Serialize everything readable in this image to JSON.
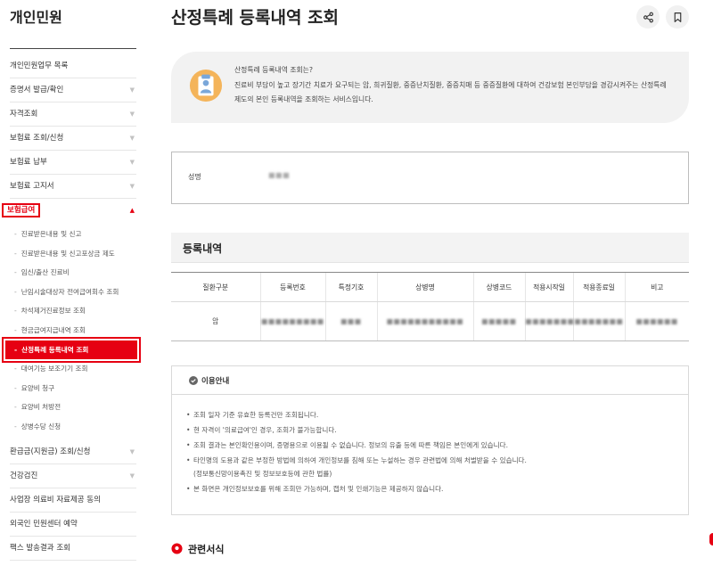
{
  "sidebar": {
    "title": "개인민원",
    "items": [
      {
        "label": "개인민원업무 목록",
        "has_arrow": false
      },
      {
        "label": "증명서 발급/확인",
        "has_arrow": true
      },
      {
        "label": "자격조회",
        "has_arrow": true
      },
      {
        "label": "보험료 조회/신청",
        "has_arrow": true
      },
      {
        "label": "보험료 납부",
        "has_arrow": true
      },
      {
        "label": "보험료 고지서",
        "has_arrow": true
      }
    ],
    "active_item": {
      "label": "보험급여",
      "arrow": "▲"
    },
    "sub_items": [
      "진료받은내용 및 신고",
      "진료받은내용 및 신고포상금 제도",
      "임신/출산 진료비",
      "난임시술대상자 전여급여회수 조회",
      "차석제거진료정보 조회",
      "현금급여지급내역 조회",
      "산정특례 등록내역 조회",
      "대여기능 보조기기 조회",
      "요양비 청구",
      "요양비 처방전",
      "상병수당 신청"
    ],
    "items_after": [
      {
        "label": "환급금(지원금) 조회/신청",
        "has_arrow": true
      },
      {
        "label": "건강검진",
        "has_arrow": true
      },
      {
        "label": "사업장 의료비 자료제공 동의",
        "has_arrow": false
      },
      {
        "label": "외국인 민원센터 예약",
        "has_arrow": false
      },
      {
        "label": "팩스 발송결과 조회",
        "has_arrow": false
      }
    ],
    "arrow_glyph": "▼"
  },
  "page": {
    "title": "산정특례 등록내역 조회",
    "share_icon": "share-icon",
    "bookmark_icon": "bookmark-icon"
  },
  "intro": {
    "question": "산정특례 등록내역 조회는?",
    "description": "진료비 부담이 높고 장기간 치료가 요구되는 암, 희귀질환, 중증난치질환, 중증치매 등 중증질환에 대하여 건강보험 본인부담을 경감시켜주는 산정특례 제도의 본인 등록내역을 조회하는 서비스입니다."
  },
  "name_box": {
    "label": "성명",
    "value": "■■■"
  },
  "registration": {
    "section_title": "등록내역",
    "columns": [
      "질환구분",
      "등록번호",
      "특정기호",
      "상병명",
      "상병코드",
      "적용시작일",
      "적용종료일",
      "비고"
    ],
    "rows": [
      [
        "암",
        "■■■■■■■■■",
        "■■■",
        "■■■■■■■■■■■",
        "■■■■■",
        "■■■■■■■",
        "■■■■■■■",
        "■■■■■■"
      ]
    ]
  },
  "notice": {
    "title": "이용안내",
    "items": [
      {
        "text": "조회 일자 기준 유효한 등록건만 조회됩니다.",
        "sub": ""
      },
      {
        "text": "현 자격이 '의료급여'인 경우, 조회가 불가능합니다.",
        "sub": ""
      },
      {
        "text": "조회 결과는 본인확인용이며, 증명용으로 이용될 수 없습니다. 정보의 유출 등에 따른 책임은 본인에게 있습니다.",
        "sub": ""
      },
      {
        "text": "타인명의 도용과 같은 부정한 방법에 의하여 개인정보를 침해 또는 누설하는 경우 관련법에 의해 처벌받을 수 있습니다.",
        "sub": "(정보통신망이용촉진 및 정보보호등에 관한 법률)"
      },
      {
        "text": "본 화면은 개인정보보호를 위해 조회만 가능하며, 캡처 및 인쇄기능은 제공하지 않습니다.",
        "sub": ""
      }
    ]
  },
  "related": {
    "title": "관련서식"
  },
  "colors": {
    "accent_red": "#e60012",
    "panel_gray": "#f2f2f2",
    "border_gray": "#d9d9d9"
  }
}
